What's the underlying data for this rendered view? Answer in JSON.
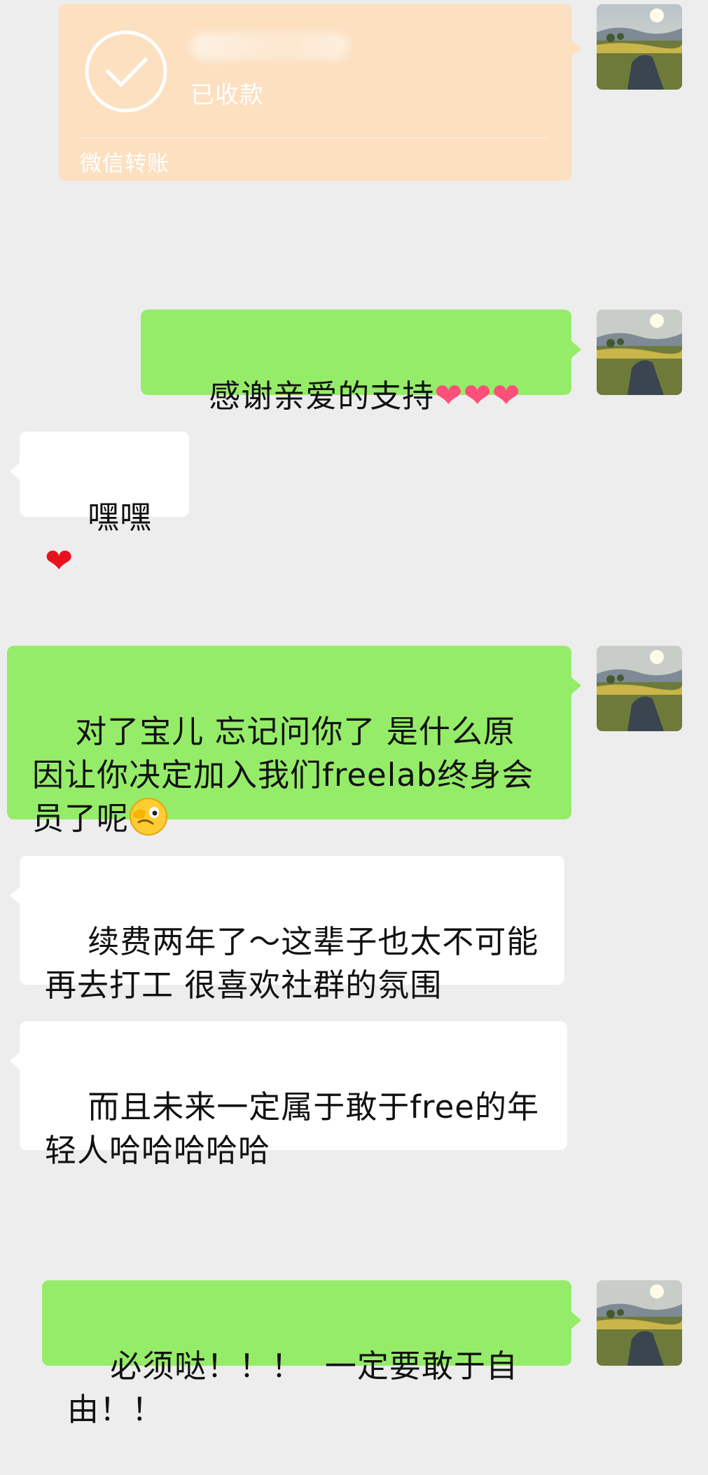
{
  "transfer": {
    "status": "已收款",
    "footer": "微信转账"
  },
  "messages": {
    "thanks": "感谢亲爱的支持",
    "hearts": "❤❤❤",
    "heihei": "嘿嘿",
    "red_heart": "❤",
    "question": "对了宝儿 忘记问你了 是什么原因让你决定加入我们freelab终身会员了呢",
    "renew": "续费两年了～这辈子也太不可能再去打工 很喜欢社群的氛围",
    "future": "而且未来一定属于敢于free的年轻人哈哈哈哈哈",
    "must": "必须哒！！！  一定要敢于自由！！"
  },
  "icons": {
    "check": "check-circle-icon",
    "heart": "heart-emoji",
    "face": "smirk-face-emoji"
  },
  "colors": {
    "background": "#ededed",
    "outgoing_bubble": "#95ec69",
    "incoming_bubble": "#ffffff",
    "transfer_card": "#fce0c0"
  }
}
